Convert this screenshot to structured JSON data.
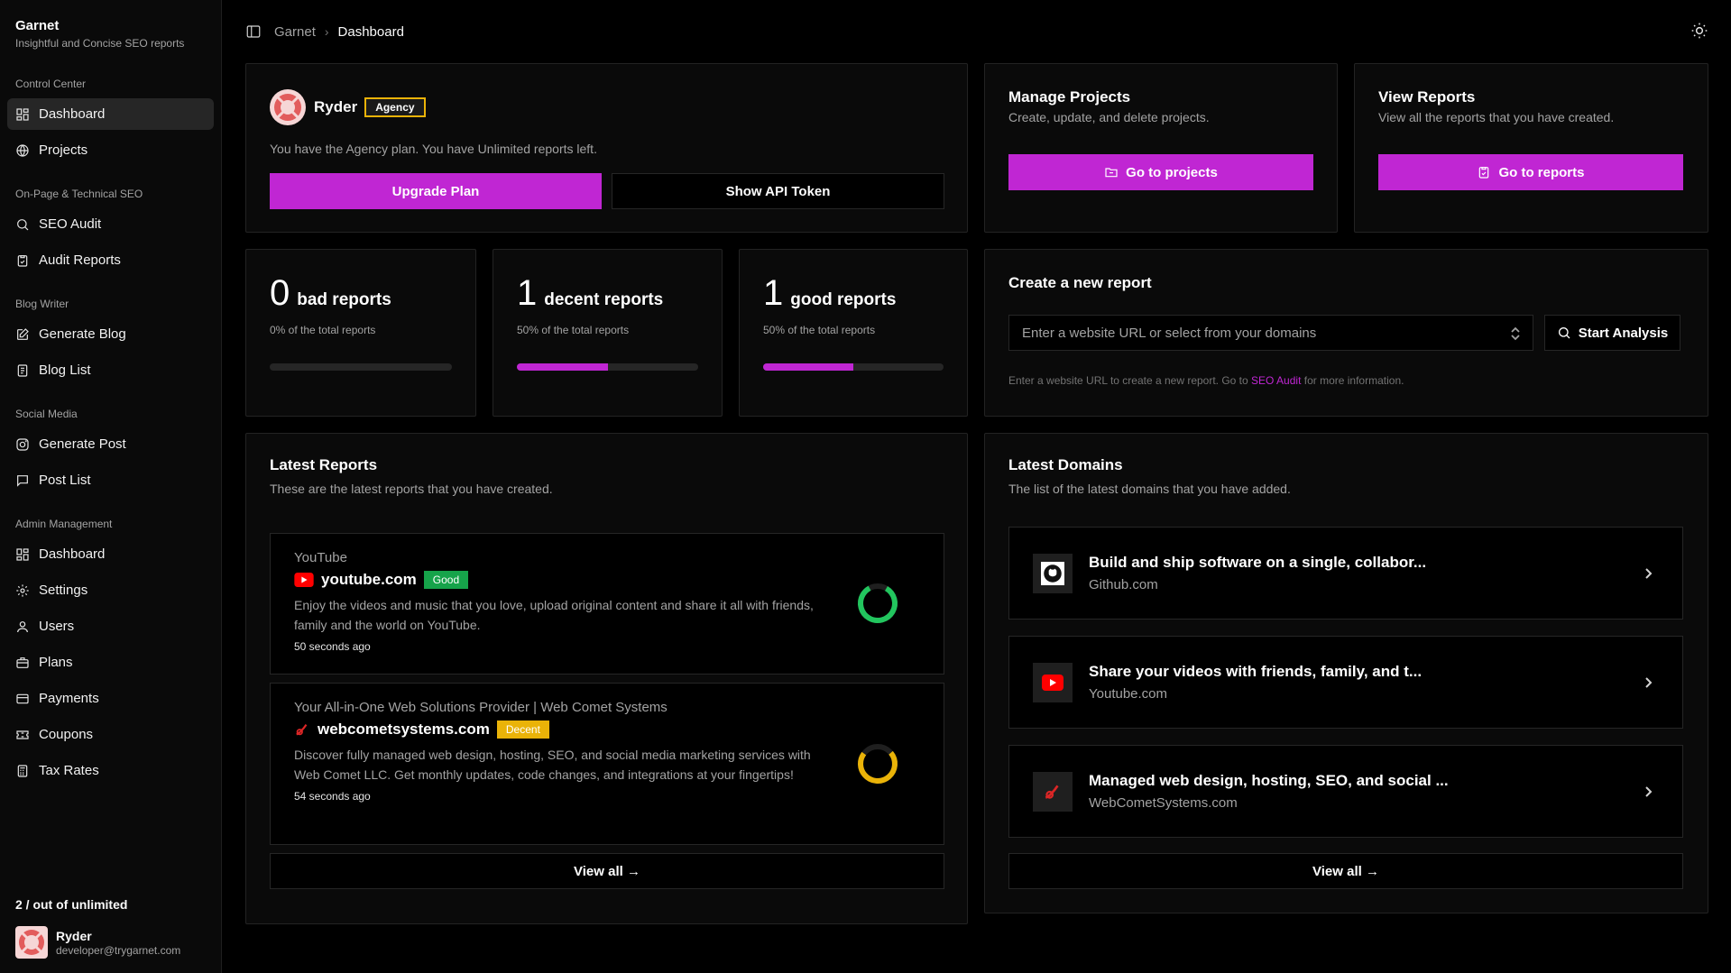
{
  "brand": {
    "name": "Garnet",
    "tagline": "Insightful and Concise SEO reports"
  },
  "sidebar": {
    "groups": [
      {
        "label": "Control Center",
        "items": [
          {
            "label": "Dashboard",
            "icon": "layout-grid-icon",
            "active": true
          },
          {
            "label": "Projects",
            "icon": "globe-icon"
          }
        ]
      },
      {
        "label": "On-Page & Technical SEO",
        "items": [
          {
            "label": "SEO Audit",
            "icon": "search-icon"
          },
          {
            "label": "Audit Reports",
            "icon": "clipboard-check-icon"
          }
        ]
      },
      {
        "label": "Blog Writer",
        "items": [
          {
            "label": "Generate Blog",
            "icon": "edit-icon"
          },
          {
            "label": "Blog List",
            "icon": "scroll-icon"
          }
        ]
      },
      {
        "label": "Social Media",
        "items": [
          {
            "label": "Generate Post",
            "icon": "instagram-icon"
          },
          {
            "label": "Post List",
            "icon": "message-square-icon"
          }
        ]
      },
      {
        "label": "Admin Management",
        "items": [
          {
            "label": "Dashboard",
            "icon": "layout-grid-icon"
          },
          {
            "label": "Settings",
            "icon": "gear-icon"
          },
          {
            "label": "Users",
            "icon": "user-icon"
          },
          {
            "label": "Plans",
            "icon": "briefcase-icon"
          },
          {
            "label": "Payments",
            "icon": "credit-card-icon"
          },
          {
            "label": "Coupons",
            "icon": "ticket-icon"
          },
          {
            "label": "Tax Rates",
            "icon": "calculator-icon"
          }
        ]
      }
    ],
    "usage": "2 / out of unlimited",
    "user": {
      "name": "Ryder",
      "email": "developer@trygarnet.com"
    }
  },
  "header": {
    "breadcrumb": [
      "Garnet",
      "Dashboard"
    ]
  },
  "plan_card": {
    "user_name": "Ryder",
    "plan_badge": "Agency",
    "message": "You have the Agency plan. You have Unlimited reports left.",
    "upgrade_label": "Upgrade Plan",
    "api_token_label": "Show API Token"
  },
  "manage_projects": {
    "title": "Manage Projects",
    "subtitle": "Create, update, and delete projects.",
    "button": "Go to projects"
  },
  "view_reports": {
    "title": "View Reports",
    "subtitle": "View all the reports that you have created.",
    "button": "Go to reports"
  },
  "stats": [
    {
      "count": "0",
      "label": "bad reports",
      "sub": "0% of the total reports",
      "percent": 0
    },
    {
      "count": "1",
      "label": "decent reports",
      "sub": "50% of the total reports",
      "percent": 50
    },
    {
      "count": "1",
      "label": "good reports",
      "sub": "50% of the total reports",
      "percent": 50
    }
  ],
  "new_report": {
    "title": "Create a new report",
    "placeholder": "Enter a website URL or select from your domains",
    "button": "Start Analysis",
    "help_prefix": "Enter a website URL to create a new report. Go to",
    "help_link": "SEO Audit",
    "help_suffix": "for more information."
  },
  "latest_reports": {
    "title": "Latest Reports",
    "subtitle": "These are the latest reports that you have created.",
    "items": [
      {
        "site_title": "YouTube",
        "domain": "youtube.com",
        "badge": "Good",
        "description": "Enjoy the videos and music that you love, upload original content and share it all with friends, family and the world on YouTube.",
        "time": "50 seconds ago",
        "score_color": "#22c55e"
      },
      {
        "site_title": "Your All-in-One Web Solutions Provider | Web Comet Systems",
        "domain": "webcometsystems.com",
        "badge": "Decent",
        "description": "Discover fully managed web design, hosting, SEO, and social media marketing services with Web Comet LLC. Get monthly updates, code changes, and integrations at your fingertips!",
        "time": "54 seconds ago",
        "score_color": "#eab308"
      }
    ],
    "view_all": "View all →"
  },
  "latest_domains": {
    "title": "Latest Domains",
    "subtitle": "The list of the latest domains that you have added.",
    "items": [
      {
        "title": "Build and ship software on a single, collabor...",
        "url": "Github.com",
        "icon": "github-icon"
      },
      {
        "title": "Share your videos with friends, family, and t...",
        "url": "Youtube.com",
        "icon": "youtube-icon"
      },
      {
        "title": "Managed web design, hosting, SEO, and social ...",
        "url": "WebCometSystems.com",
        "icon": "webcomet-icon"
      }
    ],
    "view_all": "View all →"
  },
  "colors": {
    "accent": "#c026d3",
    "good": "#16a34a",
    "decent": "#eab308"
  }
}
